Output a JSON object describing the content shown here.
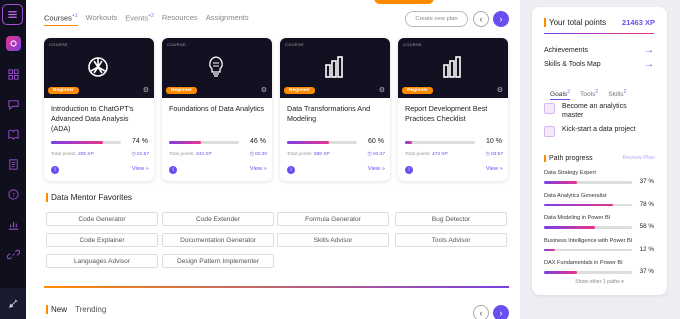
{
  "sidebar": {
    "icons": [
      "menu-icon",
      "logo-icon",
      "dashboard-icon",
      "chat-icon",
      "book-icon",
      "document-icon",
      "help-icon",
      "chart-icon",
      "link-icon",
      "settings-icon"
    ]
  },
  "main": {
    "tabs": [
      {
        "label": "Courses",
        "count": "+1",
        "active": true
      },
      {
        "label": "Workouts",
        "count": "",
        "active": false
      },
      {
        "label": "Events",
        "count": "+2",
        "active": false
      },
      {
        "label": "Resources",
        "count": "",
        "active": false
      },
      {
        "label": "Assignments",
        "count": "",
        "active": false
      }
    ],
    "create_plan_label": "Create new plan"
  },
  "courses": [
    {
      "type": "COURSE",
      "badge": "Beginner",
      "icon": "openai-icon",
      "title": "Introduction to ChatGPT's Advanced Data Analysis (ADA)",
      "percent": "74 %",
      "progress": 0.74,
      "points_label": "Total points:",
      "points": "208 XP",
      "time": "01:57",
      "view": "View"
    },
    {
      "type": "COURSE",
      "badge": "Beginner",
      "icon": "lightbulb-icon",
      "title": "Foundations of Data Analytics",
      "percent": "46 %",
      "progress": 0.46,
      "points_label": "Total points:",
      "points": "244 XP",
      "time": "02:30",
      "view": "View"
    },
    {
      "type": "COURSE",
      "badge": "Beginner",
      "icon": "powerbi-icon",
      "title": "Data Transformations And Modeling",
      "percent": "60 %",
      "progress": 0.6,
      "points_label": "Total points:",
      "points": "588 XP",
      "time": "04:47",
      "view": "View"
    },
    {
      "type": "COURSE",
      "badge": "Beginner",
      "icon": "powerbi-icon",
      "title": "Report Development Best Practices Checklist",
      "percent": "10 %",
      "progress": 0.1,
      "points_label": "Total points:",
      "points": "473 XP",
      "time": "03:57",
      "view": "View"
    }
  ],
  "favorites": {
    "title": "Data Mentor Favorites",
    "items": [
      "Code Generator",
      "Code Extender",
      "Formula Generator",
      "Bug Detector",
      "Code Explainer",
      "Documentation Generator",
      "Skills Advisor",
      "Tools Advisor",
      "Languages Advisor",
      "Design Pattern Implementer"
    ]
  },
  "bottom_tabs": [
    {
      "label": "New",
      "active": true
    },
    {
      "label": "Trending",
      "active": false
    }
  ],
  "panel": {
    "title": "Your total points",
    "xp": "21463 XP",
    "links": [
      "Achievements",
      "Skills & Tools Map"
    ],
    "tabs": [
      {
        "label": "Goals",
        "count": "2",
        "active": true
      },
      {
        "label": "Tools",
        "count": "2",
        "active": false
      },
      {
        "label": "Skills",
        "count": "2",
        "active": false
      }
    ],
    "goals": [
      "Become an analytics master",
      "Kick-start a data project"
    ],
    "path_title": "Path progress",
    "review_label": "Review Plan",
    "paths": [
      {
        "name": "Data Strategy Expert",
        "percent": "37 %",
        "progress": 0.37
      },
      {
        "name": "Data Analytics Generalist",
        "percent": "78 %",
        "progress": 0.78
      },
      {
        "name": "Data Modeling in Power BI",
        "percent": "58 %",
        "progress": 0.58
      },
      {
        "name": "Business Intelligence with Power BI",
        "percent": "12 %",
        "progress": 0.12
      },
      {
        "name": "DAX Fundamentals in Power BI",
        "percent": "37 %",
        "progress": 0.37
      }
    ],
    "show_other": "Show other 1 paths"
  },
  "colors": {
    "accent": "#6a4ff0",
    "orange": "#ff8a00",
    "pink": "#e8348b",
    "sidebar_bg": "#0f0f1e"
  }
}
